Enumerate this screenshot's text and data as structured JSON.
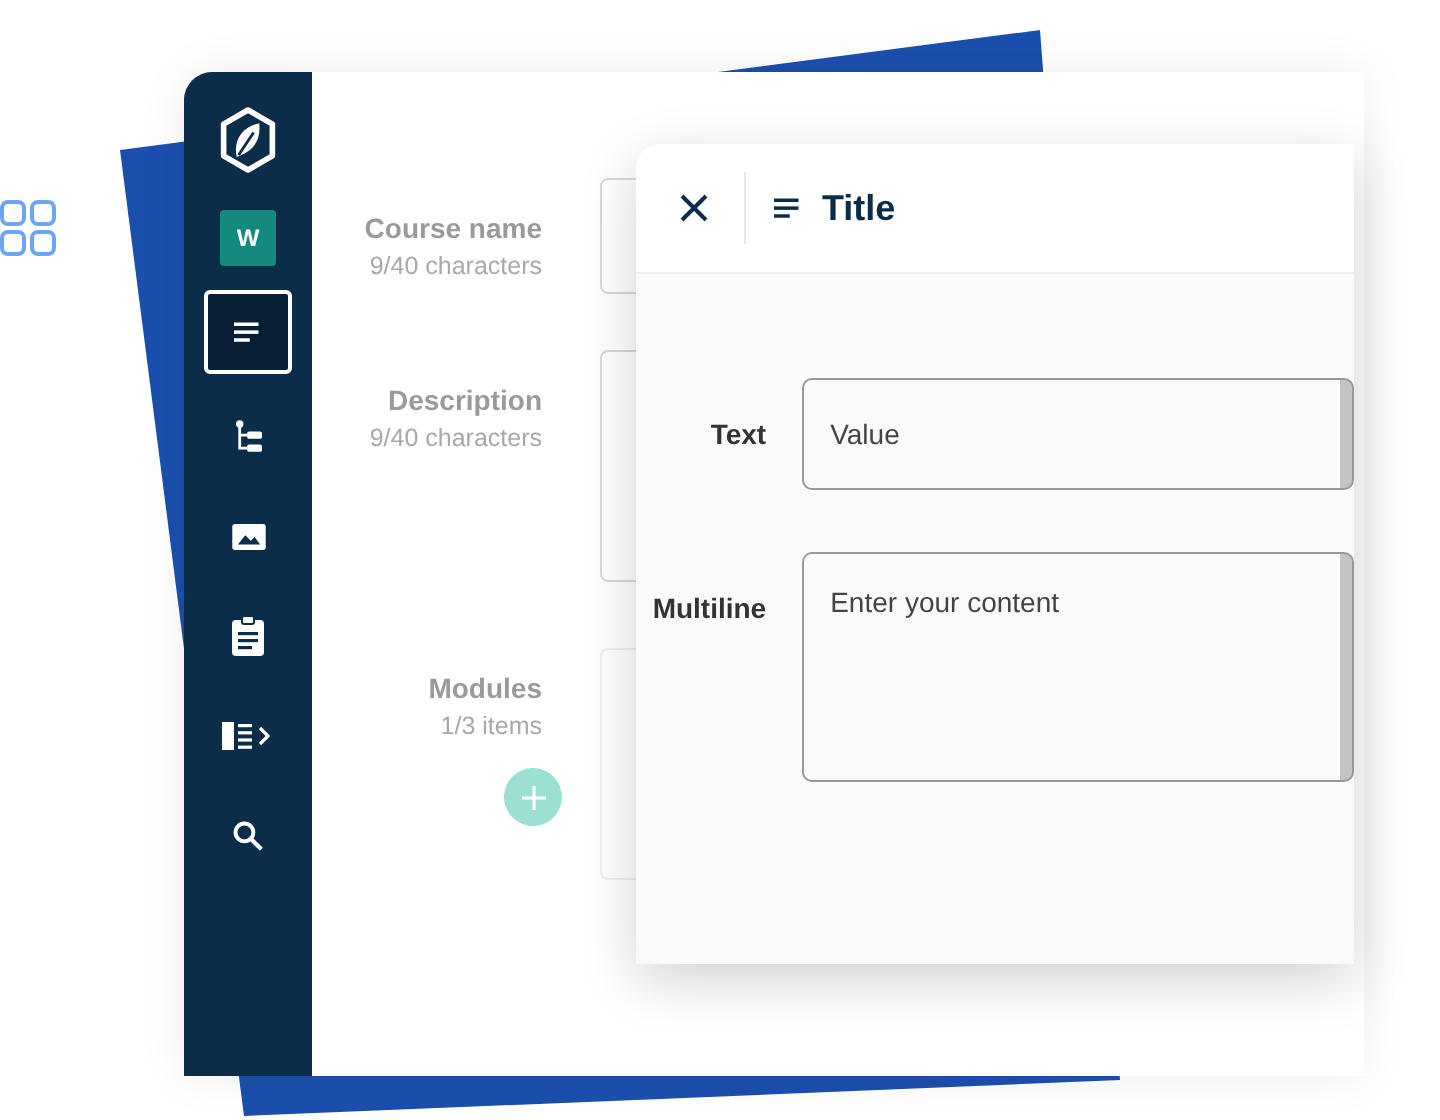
{
  "sidebar": {
    "items": [
      {
        "kind": "workspace",
        "label": "W",
        "selected": false
      },
      {
        "kind": "text",
        "selected": true
      },
      {
        "kind": "tree",
        "selected": false
      },
      {
        "kind": "image",
        "selected": false
      },
      {
        "kind": "clipboard",
        "selected": false
      },
      {
        "kind": "panel",
        "selected": false
      },
      {
        "kind": "search",
        "selected": false
      }
    ]
  },
  "form": {
    "fields": [
      {
        "label": "Course name",
        "counter": "9/40 characters",
        "kind": "input"
      },
      {
        "label": "Description",
        "counter": "9/40 characters",
        "kind": "textarea"
      },
      {
        "label": "Modules",
        "counter": "1/3 items",
        "kind": "list"
      }
    ]
  },
  "panel": {
    "title": "Title",
    "fields": [
      {
        "label": "Text",
        "value": "Value",
        "kind": "text"
      },
      {
        "label": "Multiline",
        "placeholder": "Enter your content",
        "kind": "multiline"
      }
    ]
  }
}
